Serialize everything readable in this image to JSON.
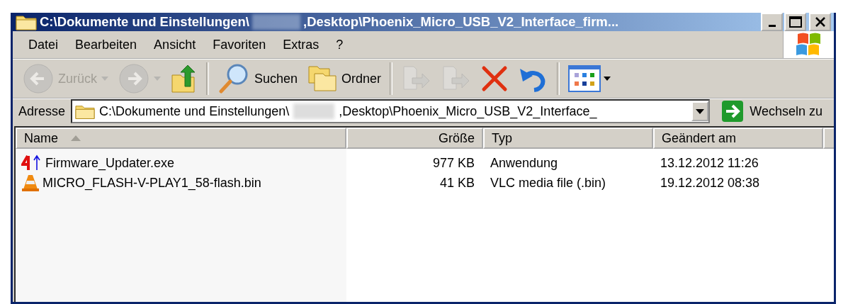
{
  "window": {
    "title_start": "C:\\Dokumente und Einstellungen\\",
    "title_end": ",Desktop\\Phoenix_Micro_USB_V2_Interface_firm..."
  },
  "menu": [
    "Datei",
    "Bearbeiten",
    "Ansicht",
    "Favoriten",
    "Extras",
    "?"
  ],
  "toolbar": [
    {
      "kind": "back",
      "label": "Zurück",
      "disabled": true
    },
    {
      "kind": "forward",
      "disabled": true
    },
    {
      "kind": "up",
      "disabled": false
    },
    {
      "kind": "search",
      "label": "Suchen",
      "disabled": false
    },
    {
      "kind": "folders",
      "label": "Ordner",
      "disabled": false
    },
    {
      "kind": "move",
      "disabled": true
    },
    {
      "kind": "copy",
      "disabled": true
    },
    {
      "kind": "delete",
      "disabled": false
    },
    {
      "kind": "undo",
      "disabled": false
    },
    {
      "kind": "views",
      "disabled": false
    }
  ],
  "address": {
    "label": "Adresse",
    "value_start": "C:\\Dokumente und Einstellungen\\",
    "value_end": ",Desktop\\Phoenix_Micro_USB_V2_Interface_",
    "go": "Wechseln zu"
  },
  "table": {
    "columns": [
      {
        "label": "Name",
        "sorted": true
      },
      {
        "label": "Größe",
        "sorted": false
      },
      {
        "label": "Typ",
        "sorted": false
      },
      {
        "label": "Geändert am",
        "sorted": false
      }
    ],
    "rows": [
      {
        "kind": "app",
        "cells": [
          "Firmware_Updater.exe",
          "977 KB",
          "Anwendung",
          "13.12.2012 11:26"
        ]
      },
      {
        "kind": "media",
        "cells": [
          "MICRO_FLASH-V-PLAY1_58-flash.bin",
          "41 KB",
          "VLC media file (.bin)",
          "19.12.2012 08:38"
        ]
      }
    ]
  }
}
